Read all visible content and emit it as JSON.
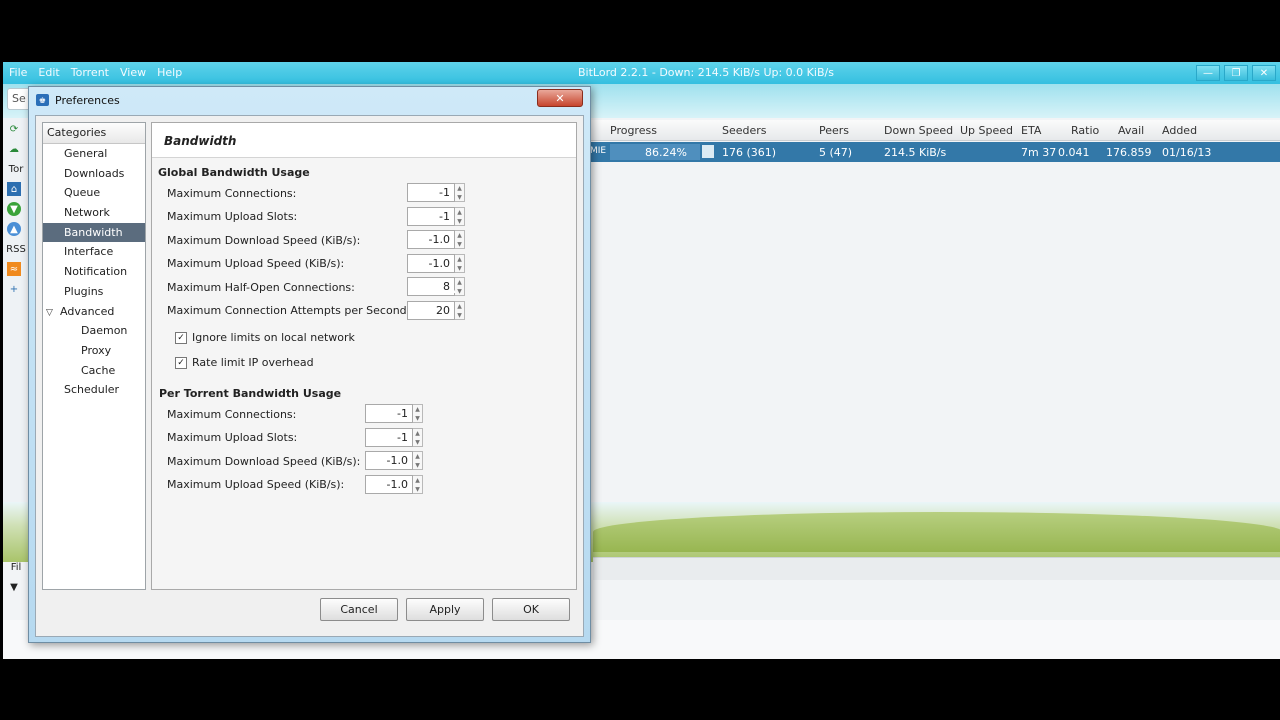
{
  "app": {
    "title": "BitLord 2.2.1 - Down: 214.5 KiB/s Up: 0.0 KiB/s",
    "menu": [
      "File",
      "Edit",
      "Torrent",
      "View",
      "Help"
    ],
    "search_placeholder": "Se",
    "left_labels": [
      "Tor",
      "RSS",
      "Fil"
    ]
  },
  "torrent_table": {
    "columns": [
      "Progress",
      "Seeders",
      "Peers",
      "Down Speed",
      "Up Speed",
      "ETA",
      "Ratio",
      "Avail",
      "Added"
    ],
    "rows": [
      {
        "name": "MIE",
        "progress": "86.24%",
        "progress_fraction": 0.8624,
        "seeders": "176 (361)",
        "peers": "5 (47)",
        "down_speed": "214.5 KiB/s",
        "up_speed": "",
        "eta": "7m 37",
        "ratio": "0.041",
        "avail": "176.859",
        "added": "01/16/13"
      }
    ]
  },
  "dialog": {
    "title": "Preferences",
    "categories_header": "Categories",
    "categories": [
      {
        "label": "General"
      },
      {
        "label": "Downloads"
      },
      {
        "label": "Queue"
      },
      {
        "label": "Network"
      },
      {
        "label": "Bandwidth",
        "selected": true
      },
      {
        "label": "Interface"
      },
      {
        "label": "Notification"
      },
      {
        "label": "Plugins"
      },
      {
        "label": "Advanced",
        "expanded": true
      },
      {
        "label": "Daemon",
        "child": true
      },
      {
        "label": "Proxy",
        "child": true
      },
      {
        "label": "Cache",
        "child": true
      },
      {
        "label": "Scheduler"
      }
    ],
    "panel_title": "Bandwidth",
    "global": {
      "header": "Global Bandwidth Usage",
      "fields": [
        {
          "label": "Maximum Connections:",
          "value": "-1"
        },
        {
          "label": "Maximum Upload Slots:",
          "value": "-1"
        },
        {
          "label": "Maximum Download Speed (KiB/s):",
          "value": "-1.0"
        },
        {
          "label": "Maximum Upload Speed (KiB/s):",
          "value": "-1.0"
        },
        {
          "label": "Maximum Half-Open Connections:",
          "value": "8"
        },
        {
          "label": "Maximum Connection Attempts per Second:",
          "value": "20"
        }
      ],
      "checkboxes": [
        {
          "label": "Ignore limits on local network",
          "checked": true
        },
        {
          "label": "Rate limit IP overhead",
          "checked": true
        }
      ]
    },
    "per_torrent": {
      "header": "Per Torrent Bandwidth Usage",
      "fields": [
        {
          "label": "Maximum Connections:",
          "value": "-1"
        },
        {
          "label": "Maximum Upload Slots:",
          "value": "-1"
        },
        {
          "label": "Maximum Download Speed (KiB/s):",
          "value": "-1.0"
        },
        {
          "label": "Maximum Upload Speed (KiB/s):",
          "value": "-1.0"
        }
      ]
    },
    "buttons": {
      "cancel": "Cancel",
      "apply": "Apply",
      "ok": "OK"
    }
  }
}
